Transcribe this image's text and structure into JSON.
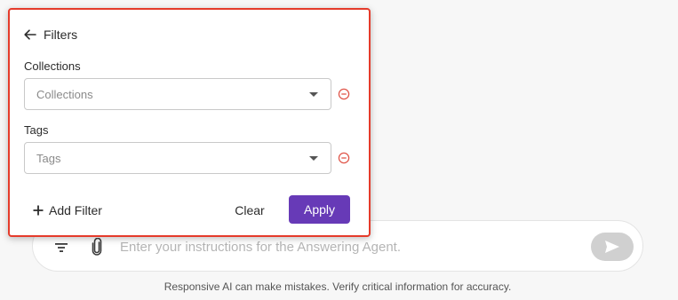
{
  "filters_panel": {
    "title": "Filters",
    "back_icon": "arrow-left-icon",
    "fields": [
      {
        "label": "Collections",
        "placeholder": "Collections",
        "remove_icon": "minus-circle-icon"
      },
      {
        "label": "Tags",
        "placeholder": "Tags",
        "remove_icon": "minus-circle-icon"
      }
    ],
    "add_filter_label": "Add Filter",
    "add_icon": "plus-icon",
    "clear_label": "Clear",
    "apply_label": "Apply"
  },
  "chat": {
    "input_placeholder": "Enter your instructions for the Answering Agent.",
    "filter_icon": "filter-icon",
    "attach_icon": "paperclip-icon",
    "send_icon": "send-icon"
  },
  "disclaimer": "Responsive AI can make mistakes. Verify critical information for accuracy.",
  "colors": {
    "accent": "#673ab7",
    "highlight_border": "#e53b2b",
    "remove_icon": "#e0574b",
    "send_button_disabled": "#d0d0d0"
  }
}
